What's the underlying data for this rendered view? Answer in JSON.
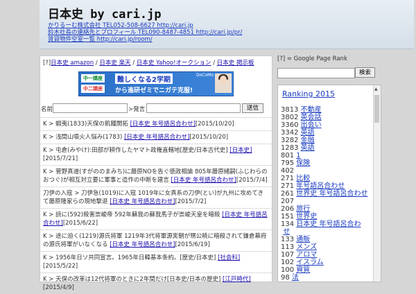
{
  "header": {
    "title": "日本史 by cari.jp",
    "links": [
      "かりるーむ株式会社 TEL052-508-6627 http://cari.jp",
      "鈴木社長の連絡先とプロフィール TEL090-8487-4851 http://cari.jp/pr/",
      "賃貸物件空室一覧 http://cari.jp/room/"
    ]
  },
  "nav": {
    "open": "[?]",
    "items": [
      "日本史 amazon",
      "日本史 楽天",
      "日本史 Yahoo!オークション",
      "日本史 掲示板"
    ],
    "sep": "/"
  },
  "ad": {
    "badge1": "中一講座",
    "badge2": "中二講座",
    "line1": "難しくなる2学期",
    "line2": "から進研ゼミでニガテ克服!",
    "corner": "DoCoMo"
  },
  "form": {
    "name_label": "名前",
    "comment_label": "≻発言",
    "submit": "送信"
  },
  "posts": [
    {
      "text": "K > 蝦夷(1833)天保の飢饉開拓 ",
      "link": "[日本史 年号語呂合わせ]",
      "date": "[2015/10/20]"
    },
    {
      "text": "K > 浅間山噴火人悩み(1783) ",
      "link": "[日本史 年号語呂合わせ]",
      "date": "[2015/10/20]"
    },
    {
      "text": "K > 屯倉(みやけ):田部が耕作したヤマト政権直轄地[歴史/日本古代史] ",
      "link": "[日本史]",
      "date": "[2015/7/21]"
    },
    {
      "text": "K > 菅野真道(すがののまみち)に藤原NOを告ぐ徳政相論 805年藤原緒嗣(ふじわらのおつぐ)が相互対立要に軍事と造作の中断を建言 ",
      "link": "[日本史 年号語呂合わせ]",
      "date": "[2015/7/4]"
    },
    {
      "text": "刀伊の入寇 > 刀伊急(1019)に入寇 1019年に女真系の刀伊(とい)が九州に攻めてきて藤原隆家らの現地撃退 ",
      "link": "[日本史 年号語呂合わせ]",
      "date": "[2015/7/2]"
    },
    {
      "text": "K > 読に(592)殺害崇峻帝 592年蘇我の蘇我馬子が崇峻天皇を暗殺 ",
      "link": "[日本史 年号語呂合わせ]",
      "date": "[2015/6/22]"
    },
    {
      "text": "K > 途に迫く(1219)源氏将軍 1219年3代将軍源実朝が甥公暁に暗殺されて鎌倉幕府の源氏将軍がいなくなる ",
      "link": "[日本史 年号語呂合わせ]",
      "date": "[2015/6/19]"
    },
    {
      "text": "K > 1956年日ソ共同宣言。1965年日韓基本条約。[歴史/日本史] ",
      "link": "[社会科]",
      "date": "[2015/5/22]"
    },
    {
      "text": "K > 天保の改革は12代将軍のときに2年間だけ[日本史/日本の歴史] ",
      "link": "[江戸時代]",
      "date": "[2015/4/9]"
    }
  ],
  "sidebar": {
    "gpr": "[?] = Google Page Rank",
    "search_button": "検索",
    "ranking_title": "Ranking 2015",
    "ranking": [
      {
        "n": "3813",
        "t": "不動産"
      },
      {
        "n": "3802",
        "t": "英会話"
      },
      {
        "n": "3360",
        "t": "出会い"
      },
      {
        "n": "3342",
        "t": "英語"
      },
      {
        "n": "3282",
        "t": "金融"
      },
      {
        "n": "1283",
        "t": "英語"
      },
      {
        "n": "801",
        "t": "1"
      },
      {
        "n": "795",
        "t": "保険"
      },
      {
        "n": "402",
        "t": ""
      },
      {
        "n": "271",
        "t": "比較"
      },
      {
        "n": "271",
        "t": "年号語呂合わせ"
      },
      {
        "n": "261",
        "t": "世界史 年号語呂合わせ"
      },
      {
        "n": "207",
        "t": ""
      },
      {
        "n": "206",
        "t": "旅行"
      },
      {
        "n": "151",
        "t": "世界史"
      },
      {
        "n": "134",
        "t": "日本史 年号語呂合わ"
      },
      {
        "n": "",
        "t": "せ"
      },
      {
        "n": "133",
        "t": "通販"
      },
      {
        "n": "113",
        "t": "メンズ"
      },
      {
        "n": "107",
        "t": "アロマ"
      },
      {
        "n": "102",
        "t": "イスラム"
      },
      {
        "n": "100",
        "t": "資質"
      },
      {
        "n": "98",
        "t": "法"
      }
    ]
  }
}
